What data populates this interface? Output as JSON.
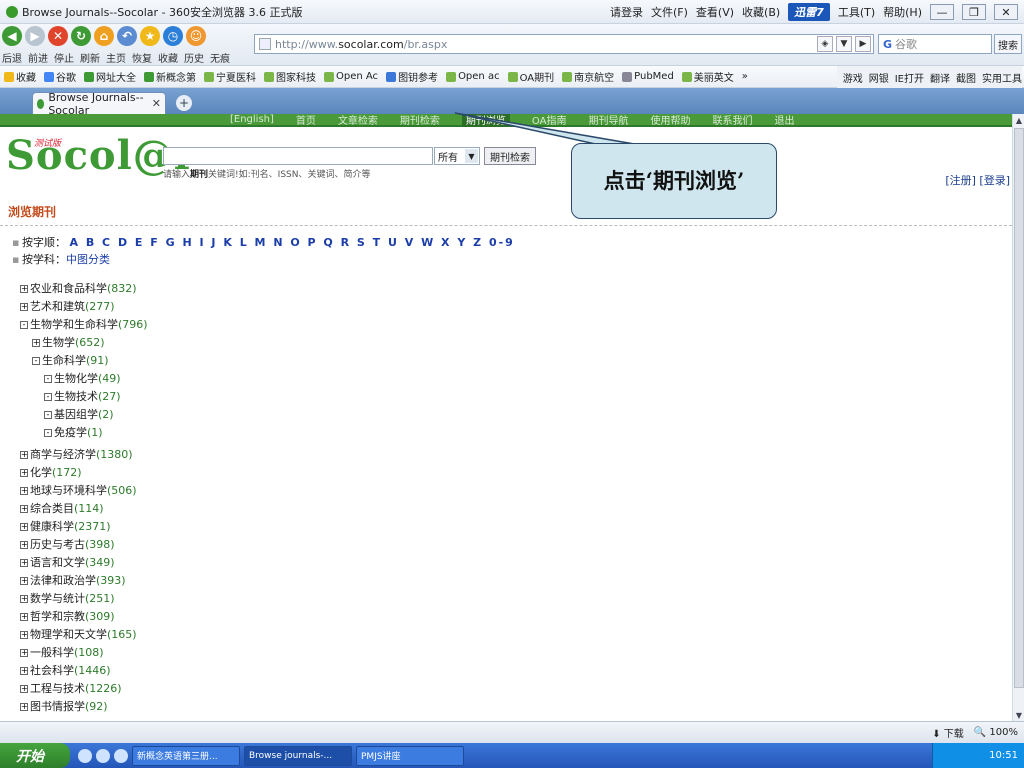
{
  "window": {
    "title": "Browse Journals--Socolar - 360安全浏览器 3.6 正式版",
    "login": "请登录",
    "menu": [
      "文件(F)",
      "查看(V)",
      "收藏(B)",
      "工具(T)",
      "帮助(H)"
    ],
    "xunlei": "迅雷7"
  },
  "nav": {
    "labels": [
      "后退",
      "前进",
      "停止",
      "刷新",
      "主页",
      "恢复",
      "收藏",
      "历史",
      "无痕"
    ],
    "url_prefix": "http://www.",
    "url_host": "socolar.com",
    "url_path": "/br.aspx",
    "search_placeholder": "谷歌",
    "search_button": "搜索"
  },
  "favorites": {
    "items": [
      "收藏",
      "谷歌",
      "网址大全",
      "新概念第",
      "宁夏医科",
      "图家科技",
      "Open Ac",
      "图钥参考",
      "Open ac",
      "OA期刊",
      "南京航空",
      "PubMed",
      "美丽英文"
    ],
    "right": [
      "游戏",
      "网银",
      "IE打开",
      "翻译",
      "截图",
      "实用工具"
    ]
  },
  "tab": {
    "label": "Browse Journals--Socolar"
  },
  "site": {
    "topnav": [
      "[English]",
      "首页",
      "文章检索",
      "期刊检索",
      "期刊浏览",
      "OA指南",
      "期刊导航",
      "使用帮助",
      "联系我们",
      "退出"
    ],
    "active_nav": "期刊浏览",
    "logo": "Socol@r",
    "beta": "测试版",
    "scope_option": "所有",
    "search_button": "期刊检索",
    "hint_prefix": "请输入",
    "hint_bold": "期刊",
    "hint_suffix": "关键词!如:刊名、ISSN、关键词、简介等",
    "register": "[注册]",
    "login": "[登录]",
    "section_title": "浏览期刊",
    "by_letter_label": "按字顺：",
    "letters": "A B C D E F G H I J K L M N O P Q R S T U V W X Y Z 0-9",
    "by_subject_label": "按学科：",
    "subject_link": "中图分类"
  },
  "tree": [
    {
      "name": "农业和食品科学",
      "count": "(832)",
      "level": 0,
      "sign": "+"
    },
    {
      "name": "艺术和建筑",
      "count": "(277)",
      "level": 0,
      "sign": "+"
    },
    {
      "name": "生物学和生命科学",
      "count": "(796)",
      "level": 0,
      "sign": "-"
    },
    {
      "name": "生物学",
      "count": "(652)",
      "level": 1,
      "sign": "+"
    },
    {
      "name": "生命科学",
      "count": "(91)",
      "level": 1,
      "sign": "-"
    },
    {
      "name": "生物化学",
      "count": "(49)",
      "level": 2,
      "sign": "-"
    },
    {
      "name": "生物技术",
      "count": "(27)",
      "level": 2,
      "sign": "-"
    },
    {
      "name": "基因组学",
      "count": "(2)",
      "level": 2,
      "sign": "-"
    },
    {
      "name": "免疫学",
      "count": " (1)",
      "level": 2,
      "sign": "-"
    },
    {
      "name": "商学与经济学",
      "count": "(1380)",
      "level": 0,
      "sign": "+"
    },
    {
      "name": "化学",
      "count": "(172)",
      "level": 0,
      "sign": "+"
    },
    {
      "name": "地球与环境科学",
      "count": "(506)",
      "level": 0,
      "sign": "+"
    },
    {
      "name": "综合类目",
      "count": "(114)",
      "level": 0,
      "sign": "+"
    },
    {
      "name": "健康科学",
      "count": "(2371)",
      "level": 0,
      "sign": "+"
    },
    {
      "name": "历史与考古",
      "count": "(398)",
      "level": 0,
      "sign": "+"
    },
    {
      "name": "语言和文学",
      "count": "(349)",
      "level": 0,
      "sign": "+"
    },
    {
      "name": "法律和政治学",
      "count": "(393)",
      "level": 0,
      "sign": "+"
    },
    {
      "name": "数学与统计",
      "count": "(251)",
      "level": 0,
      "sign": "+"
    },
    {
      "name": "哲学和宗教",
      "count": "(309)",
      "level": 0,
      "sign": "+"
    },
    {
      "name": "物理学和天文学",
      "count": "(165)",
      "level": 0,
      "sign": "+"
    },
    {
      "name": "一般科学",
      "count": "(108)",
      "level": 0,
      "sign": "+"
    },
    {
      "name": "社会科学",
      "count": "(1446)",
      "level": 0,
      "sign": "+"
    },
    {
      "name": "工程与技术",
      "count": "(1226)",
      "level": 0,
      "sign": "+"
    },
    {
      "name": "图书情报学",
      "count": "(92)",
      "level": 0,
      "sign": "+"
    }
  ],
  "callout": {
    "text": "点击‘期刊浏览’"
  },
  "status": {
    "download": "下载",
    "zoom": "100%"
  },
  "taskbar": {
    "start": "开始",
    "buttons": [
      "新概念英语第三册...",
      "Browse journals-...",
      "PMJS讲座"
    ],
    "time": "10:51"
  },
  "colors": {
    "site_green": "#4a9a3a",
    "title_orange": "#c34a1a",
    "link_blue": "#1b3ea8",
    "callout_fill": "#cfe6ee"
  }
}
